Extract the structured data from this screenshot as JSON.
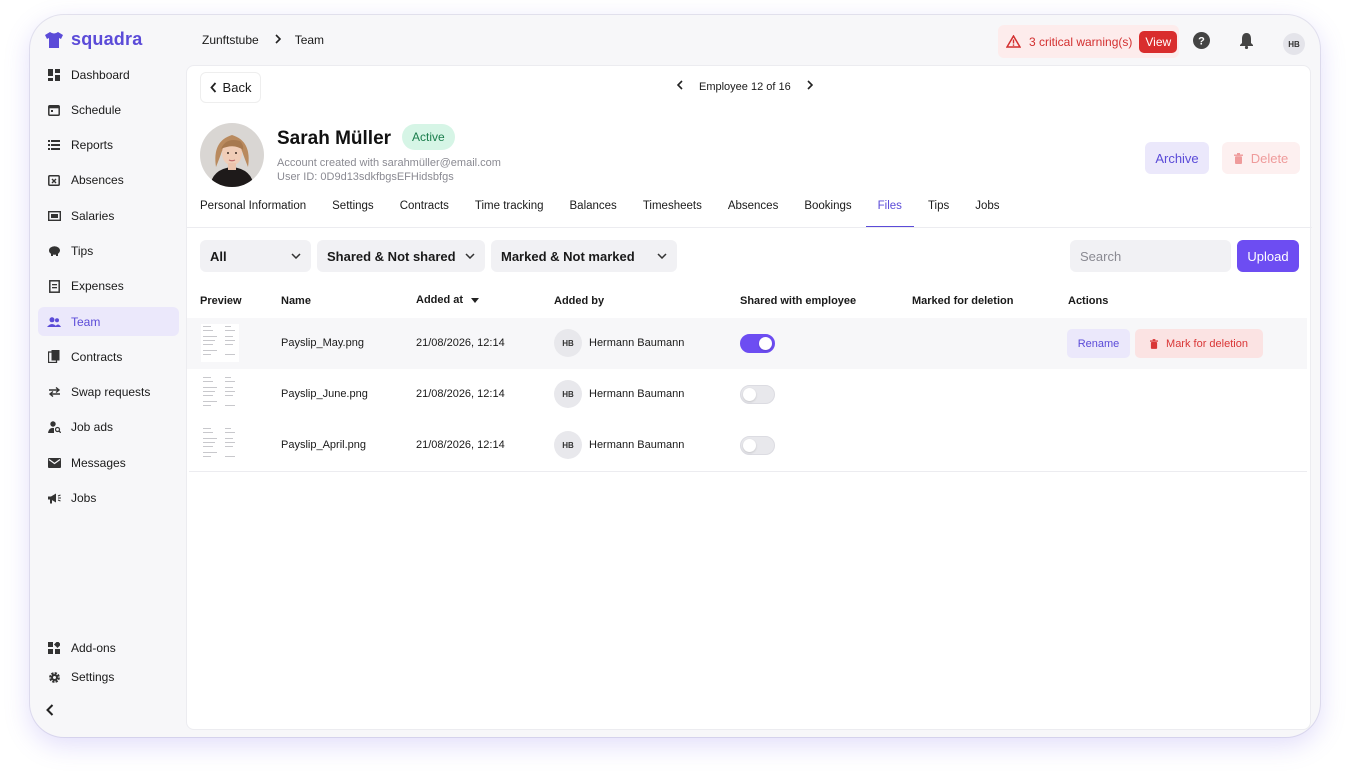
{
  "brand": {
    "name": "squadra",
    "color": "#5b4bd8"
  },
  "sidebar": {
    "items": [
      {
        "label": "Dashboard",
        "icon": "dashboard-icon"
      },
      {
        "label": "Schedule",
        "icon": "calendar-icon"
      },
      {
        "label": "Reports",
        "icon": "list-icon"
      },
      {
        "label": "Absences",
        "icon": "calendar-x-icon"
      },
      {
        "label": "Salaries",
        "icon": "money-icon"
      },
      {
        "label": "Tips",
        "icon": "piggy-bank-icon"
      },
      {
        "label": "Expenses",
        "icon": "receipt-icon"
      },
      {
        "label": "Team",
        "icon": "people-icon",
        "active": true
      },
      {
        "label": "Contracts",
        "icon": "documents-icon"
      },
      {
        "label": "Swap requests",
        "icon": "swap-icon"
      },
      {
        "label": "Job ads",
        "icon": "person-search-icon"
      },
      {
        "label": "Messages",
        "icon": "mail-icon"
      },
      {
        "label": "Jobs",
        "icon": "megaphone-icon"
      }
    ],
    "bottom_items": [
      {
        "label": "Add-ons",
        "icon": "widgets-icon"
      },
      {
        "label": "Settings",
        "icon": "gear-icon"
      }
    ]
  },
  "breadcrumb": {
    "parent": "Zunftstube",
    "current": "Team"
  },
  "header": {
    "warning_text": "3 critical warning(s)",
    "view_label": "View",
    "user_initials": "HB"
  },
  "profile": {
    "back_label": "Back",
    "pager_text": "Employee 12 of 16",
    "name": "Sarah Müller",
    "status": "Active",
    "account_line": "Account created with sarahmüller@email.com",
    "user_id_line": "User ID: 0D9d13sdkfbgsEFHidsbfgs",
    "archive_label": "Archive",
    "delete_label": "Delete"
  },
  "tabs": [
    "Personal Information",
    "Settings",
    "Contracts",
    "Time tracking",
    "Balances",
    "Timesheets",
    "Absences",
    "Bookings",
    "Files",
    "Tips",
    "Jobs"
  ],
  "active_tab": "Files",
  "filters": {
    "type": "All",
    "shared": "Shared & Not shared",
    "marked": "Marked & Not marked",
    "search_placeholder": "Search",
    "upload_label": "Upload"
  },
  "table": {
    "headers": {
      "preview": "Preview",
      "name": "Name",
      "added_at": "Added at",
      "added_by": "Added by",
      "shared": "Shared with employee",
      "marked": "Marked for deletion",
      "actions": "Actions"
    },
    "rows": [
      {
        "name": "Payslip_May.png",
        "added_at": "21/08/2026, 12:14",
        "initials": "HB",
        "added_by": "Hermann Baumann",
        "shared": true
      },
      {
        "name": "Payslip_June.png",
        "added_at": "21/08/2026, 12:14",
        "initials": "HB",
        "added_by": "Hermann Baumann",
        "shared": false
      },
      {
        "name": "Payslip_April.png",
        "added_at": "21/08/2026, 12:14",
        "initials": "HB",
        "added_by": "Hermann Baumann",
        "shared": false
      }
    ],
    "actions": {
      "rename_label": "Rename",
      "mark_label": "Mark for deletion"
    }
  }
}
